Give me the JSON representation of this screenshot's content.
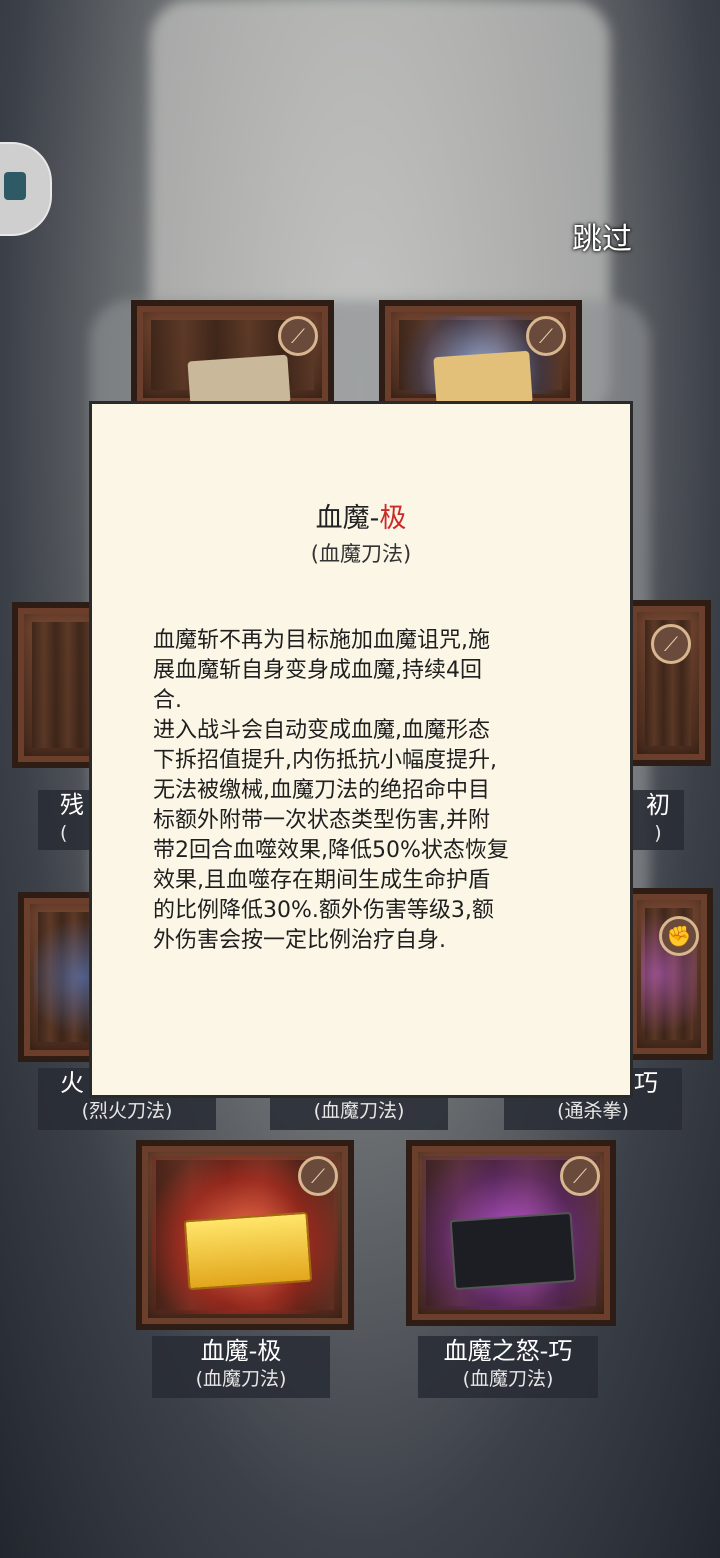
{
  "top": {
    "skip_label": "跳过"
  },
  "dialog": {
    "title_main": "血魔-",
    "title_grade": "极",
    "subtitle": "(血魔刀法)",
    "description": "血魔斩不再为目标施加血魔诅咒,施\n展血魔斩自身变身成血魔,持续4回\n合.\n进入战斗会自动变成血魔,血魔形态\n下拆招值提升,内伤抵抗小幅度提升,\n无法被缴械,血魔刀法的绝招命中目\n标额外附带一次状态类型伤害,并附\n带2回合血噬效果,降低50%状态恢复\n效果,且血噬存在期间生成生命护盾\n的比例降低30%.额外伤害等级3,额\n外伤害会按一定比例治疗自身."
  },
  "cards": {
    "left_mid": {
      "name": "残",
      "sub": "("
    },
    "right_mid": {
      "name": "初",
      "sub": ")"
    },
    "left_low": {
      "name": "火",
      "sub": "(烈火刀法)"
    },
    "center_low": {
      "sub": "(血魔刀法)"
    },
    "right_low": {
      "name": "巧",
      "sub": "(通杀拳)"
    },
    "bottom_left": {
      "name": "血魔-极",
      "sub": "(血魔刀法)"
    },
    "bottom_right": {
      "name": "血魔之怒-巧",
      "sub": "(血魔刀法)"
    }
  },
  "icons": {
    "weapon_tag": "blade-icon",
    "fist_tag": "fist-icon",
    "side_badge": "app-badge-icon"
  }
}
